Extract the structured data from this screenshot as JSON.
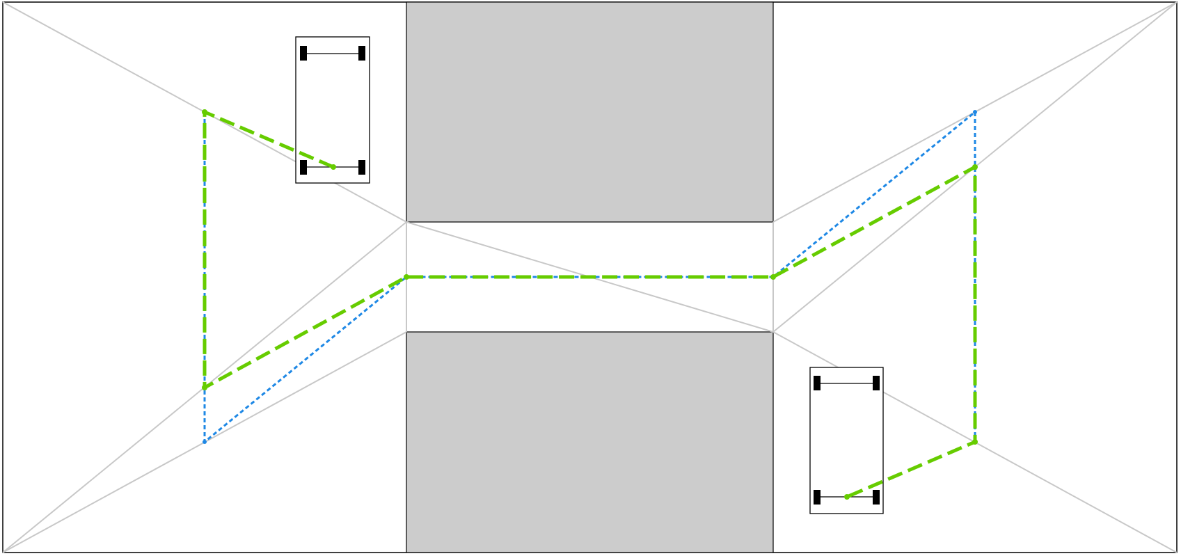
{
  "diagram": {
    "colors": {
      "background": "#ffffff",
      "border": "#000000",
      "obstacle_fill": "#cccccc",
      "graph_edge": "#c8c8c8",
      "robot": "#000000",
      "path_direct": "#1e88e5",
      "path_smoothed": "#66cc00"
    },
    "legend": []
  }
}
